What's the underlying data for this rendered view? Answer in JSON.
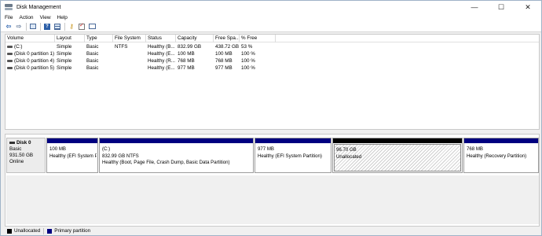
{
  "window": {
    "title": "Disk Management",
    "icon": "disk-management-icon"
  },
  "controls": {
    "minimize": "—",
    "maximize": "☐",
    "close": "✕"
  },
  "menu": [
    "File",
    "Action",
    "View",
    "Help"
  ],
  "toolbar": [
    "back-arrow-icon",
    "forward-arrow-icon",
    "show-hide-console-tree-icon",
    "help-icon",
    "list-view-icon",
    "key-icon",
    "checklist-icon",
    "properties-icon"
  ],
  "volume_list": {
    "columns": [
      "Volume",
      "Layout",
      "Type",
      "File System",
      "Status",
      "Capacity",
      "Free Spa...",
      "% Free"
    ],
    "rows": [
      [
        "(C:)",
        "Simple",
        "Basic",
        "NTFS",
        "Healthy (B...",
        "832.99 GB",
        "438.72 GB",
        "53 %"
      ],
      [
        "(Disk 0 partition 1)",
        "Simple",
        "Basic",
        "",
        "Healthy (E...",
        "100 MB",
        "100 MB",
        "100 %"
      ],
      [
        "(Disk 0 partition 4)",
        "Simple",
        "Basic",
        "",
        "Healthy (R...",
        "768 MB",
        "768 MB",
        "100 %"
      ],
      [
        "(Disk 0 partition 5)",
        "Simple",
        "Basic",
        "",
        "Healthy (E...",
        "977 MB",
        "977 MB",
        "100 %"
      ]
    ]
  },
  "disk": {
    "name": "Disk 0",
    "type": "Basic",
    "size": "931.50 GB",
    "status": "Online",
    "partitions": [
      {
        "line1": "",
        "line2": "100 MB",
        "line3": "Healthy (EFI System Pa"
      },
      {
        "line1": "(C:)",
        "line2": "832.99 GB NTFS",
        "line3": "Healthy (Boot, Page File, Crash Dump, Basic Data Partition)"
      },
      {
        "line1": "",
        "line2": "977 MB",
        "line3": "Healthy (EFI System Partition)"
      },
      {
        "line1": "",
        "line2": "96.70 GB",
        "line3": "Unallocated"
      },
      {
        "line1": "",
        "line2": "768 MB",
        "line3": "Healthy (Recovery Partition)"
      }
    ]
  },
  "legend": [
    {
      "label": "Unallocated",
      "color": "#000000"
    },
    {
      "label": "Primary partition",
      "color": "#000080"
    }
  ]
}
